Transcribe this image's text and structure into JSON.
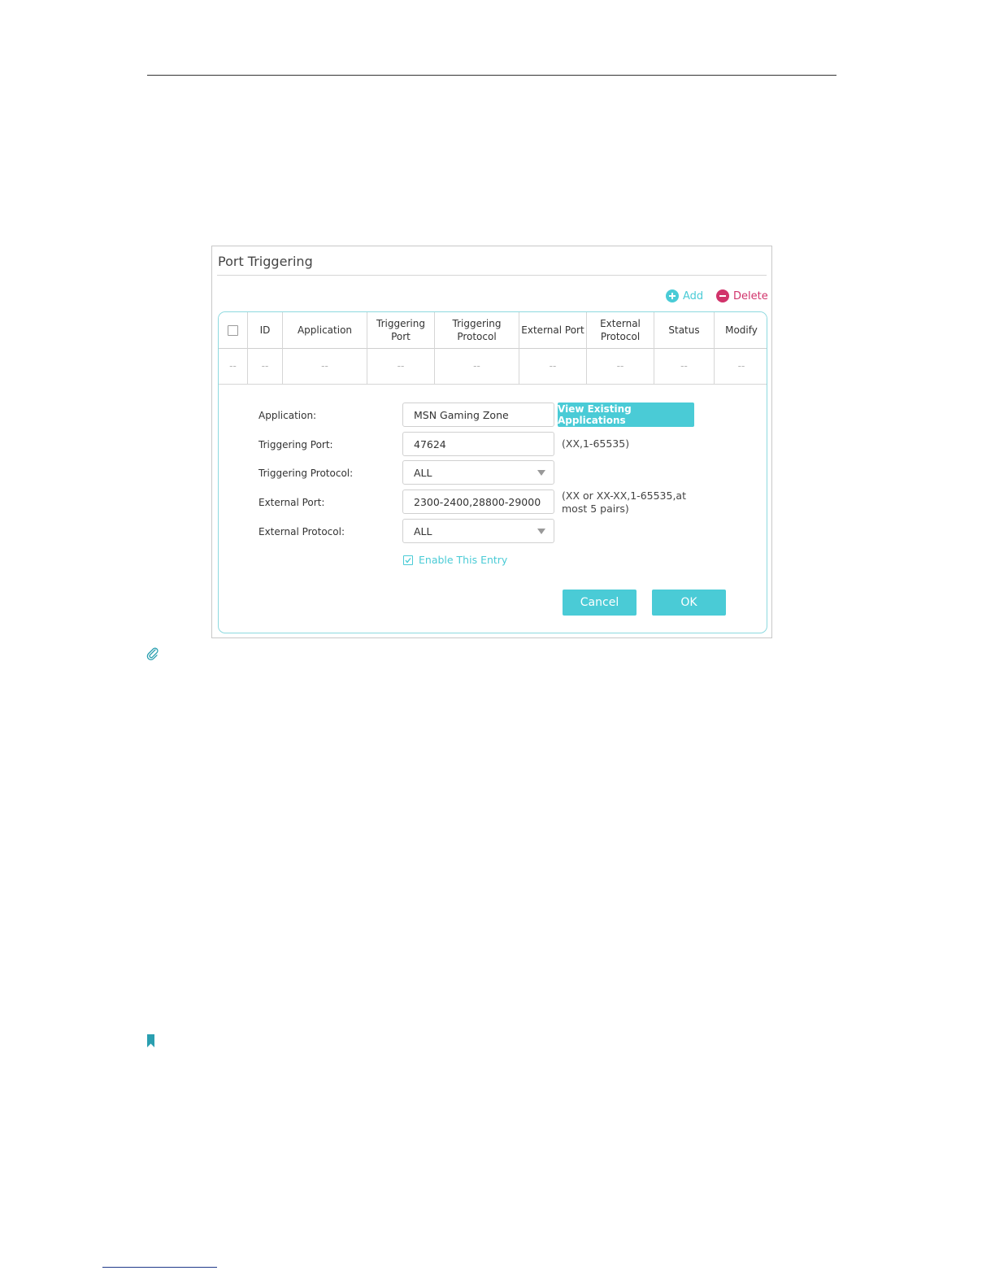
{
  "panel": {
    "title": "Port Triggering"
  },
  "actions": {
    "add_label": "Add",
    "delete_label": "Delete"
  },
  "table": {
    "headers": [
      "ID",
      "Application",
      "Triggering Port",
      "Triggering Protocol",
      "External Port",
      "External Protocol",
      "Status",
      "Modify"
    ],
    "row": [
      "--",
      "--",
      "--",
      "--",
      "--",
      "--",
      "--",
      "--",
      "--"
    ]
  },
  "form": {
    "application_label": "Application:",
    "application_value": "MSN Gaming Zone",
    "view_button": "View Existing Applications",
    "triggering_port_label": "Triggering Port:",
    "triggering_port_value": "47624",
    "triggering_port_hint": "(XX,1-65535)",
    "triggering_protocol_label": "Triggering Protocol:",
    "triggering_protocol_value": "ALL",
    "external_port_label": "External Port:",
    "external_port_value": "2300-2400,28800-29000",
    "external_port_hint": "(XX or XX-XX,1-65535,at most 5 pairs)",
    "external_protocol_label": "External Protocol:",
    "external_protocol_value": "ALL",
    "enable_label": "Enable This Entry",
    "enable_checked": true
  },
  "buttons": {
    "cancel": "Cancel",
    "ok": "OK"
  },
  "colors": {
    "accent": "#4acbd6",
    "delete": "#d1336b",
    "border": "#8dd9df"
  },
  "icons": [
    "add-icon",
    "delete-icon",
    "paperclip-icon",
    "bookmark-icon",
    "checkmark-icon",
    "dropdown-caret-icon"
  ]
}
